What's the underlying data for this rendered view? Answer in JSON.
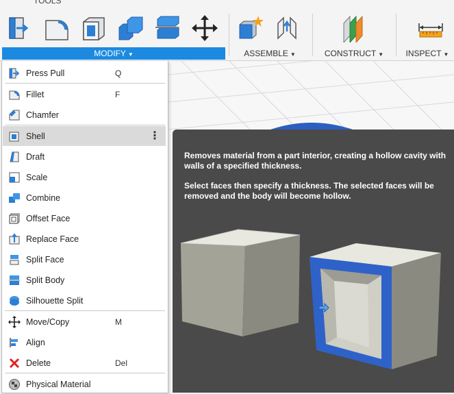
{
  "toolbar": {
    "tools_label": "TOOLS",
    "icons": [
      "press-pull-icon",
      "fillet-icon",
      "shell-icon",
      "combine-icon",
      "split-body-icon",
      "move-icon",
      "new-component-icon",
      "joint-icon",
      "offset-plane-icon",
      "measure-icon"
    ],
    "groups": {
      "modify": "MODIFY",
      "assemble": "ASSEMBLE",
      "construct": "CONSTRUCT",
      "inspect": "INSPECT"
    }
  },
  "menu": {
    "items": [
      {
        "label": "Press Pull",
        "shortcut": "Q",
        "icon": "press-pull-icon"
      },
      {
        "label": "Fillet",
        "shortcut": "F",
        "icon": "fillet-icon"
      },
      {
        "label": "Chamfer",
        "shortcut": "",
        "icon": "chamfer-icon"
      },
      {
        "label": "Shell",
        "shortcut": "",
        "icon": "shell-icon",
        "highlighted": true
      },
      {
        "label": "Draft",
        "shortcut": "",
        "icon": "draft-icon"
      },
      {
        "label": "Scale",
        "shortcut": "",
        "icon": "scale-icon"
      },
      {
        "label": "Combine",
        "shortcut": "",
        "icon": "combine-icon"
      },
      {
        "label": "Offset Face",
        "shortcut": "",
        "icon": "offset-face-icon"
      },
      {
        "label": "Replace Face",
        "shortcut": "",
        "icon": "replace-face-icon"
      },
      {
        "label": "Split Face",
        "shortcut": "",
        "icon": "split-face-icon"
      },
      {
        "label": "Split Body",
        "shortcut": "",
        "icon": "split-body-icon"
      },
      {
        "label": "Silhouette Split",
        "shortcut": "",
        "icon": "silhouette-split-icon"
      },
      {
        "label": "Move/Copy",
        "shortcut": "M",
        "icon": "move-copy-icon"
      },
      {
        "label": "Align",
        "shortcut": "",
        "icon": "align-icon"
      },
      {
        "label": "Delete",
        "shortcut": "Del",
        "icon": "delete-icon"
      },
      {
        "label": "Physical Material",
        "shortcut": "",
        "icon": "physical-material-icon"
      }
    ],
    "more_glyph": "⋮"
  },
  "tooltip": {
    "description": "Removes material from a part interior, creating a hollow cavity with walls of a specified thickness.",
    "instruction": "Select faces then specify a thickness. The selected faces will be removed and the body will become hollow."
  },
  "colors": {
    "accent": "#1b8ae0",
    "tooltip_bg": "#4a4a4a",
    "menu_highlight": "#dadada",
    "shell_wall": "#2f62c9"
  }
}
